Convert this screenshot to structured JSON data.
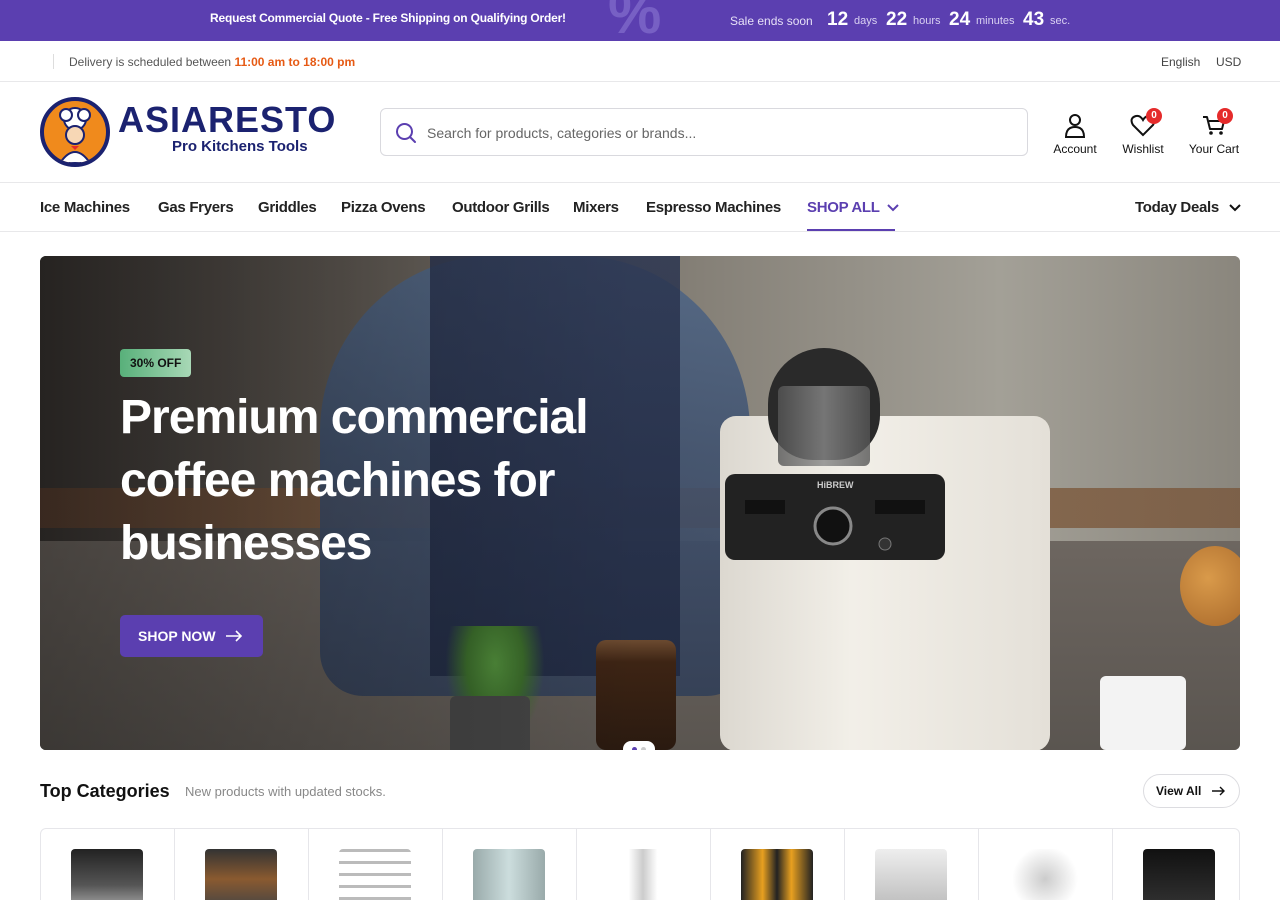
{
  "promo": {
    "text": "Request Commercial Quote - Free Shipping on Qualifying Order!",
    "sale_label": "Sale ends soon",
    "countdown": [
      {
        "value": "12",
        "unit": "days"
      },
      {
        "value": "22",
        "unit": "hours"
      },
      {
        "value": "24",
        "unit": "minutes"
      },
      {
        "value": "43",
        "unit": "sec."
      }
    ]
  },
  "topbar": {
    "delivery_prefix": "Delivery is scheduled between",
    "delivery_time": "11:00 am to 18:00 pm",
    "language": "English",
    "currency": "USD"
  },
  "header": {
    "logo_name": "ASIARESTO",
    "logo_tagline": "Pro Kitchens Tools",
    "search_placeholder": "Search for products, categories or brands...",
    "account_label": "Account",
    "wishlist_label": "Wishlist",
    "wishlist_count": "0",
    "cart_label": "Your Cart",
    "cart_count": "0"
  },
  "nav": {
    "items": [
      "Ice Machines",
      "Gas Fryers",
      "Griddles",
      "Pizza Ovens",
      "Outdoor Grills",
      "Mixers",
      "Espresso Machines",
      "SHOP ALL"
    ],
    "today_deals": "Today Deals"
  },
  "hero": {
    "badge": "30% OFF",
    "title": "Premium commercial coffee machines for businesses",
    "cta": "SHOP NOW",
    "machine_brand": "HiBREW"
  },
  "categories": {
    "title": "Top Categories",
    "subtitle": "New products with updated stocks.",
    "view_all": "View All"
  },
  "colors": {
    "brand": "#5b3fb0",
    "accent_orange": "#e65a14",
    "badge_red": "#e52b2b",
    "logo_navy": "#1b2270"
  }
}
